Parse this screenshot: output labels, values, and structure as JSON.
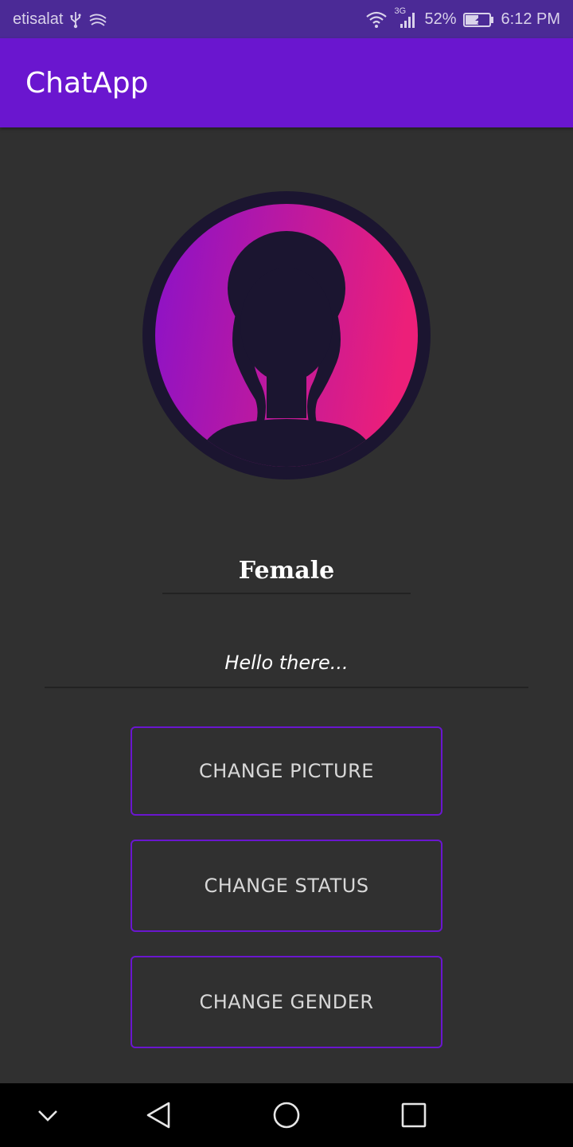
{
  "status_bar": {
    "carrier": "etisalat",
    "network_type": "3G",
    "battery": "52%",
    "time": "6:12 PM",
    "icons": [
      "usb-icon",
      "swipe-icon",
      "wifi-icon",
      "signal-icon",
      "battery-icon"
    ]
  },
  "app_bar": {
    "title": "ChatApp"
  },
  "profile": {
    "name": "Female",
    "status": "Hello there..."
  },
  "actions": {
    "change_picture": "CHANGE PICTURE",
    "change_status": "CHANGE STATUS",
    "change_gender": "CHANGE GENDER"
  },
  "nav_bar": {
    "icons": [
      "chevron-down-icon",
      "back-icon",
      "home-icon",
      "recents-icon"
    ]
  },
  "colors": {
    "status_bar": "#4b2a96",
    "app_bar": "#6a16cf",
    "background": "#303030",
    "button_border": "#6a16cf",
    "avatar_gradient_start": "#8a12c9",
    "avatar_gradient_end": "#ec1f79",
    "avatar_dark": "#1b1530"
  }
}
